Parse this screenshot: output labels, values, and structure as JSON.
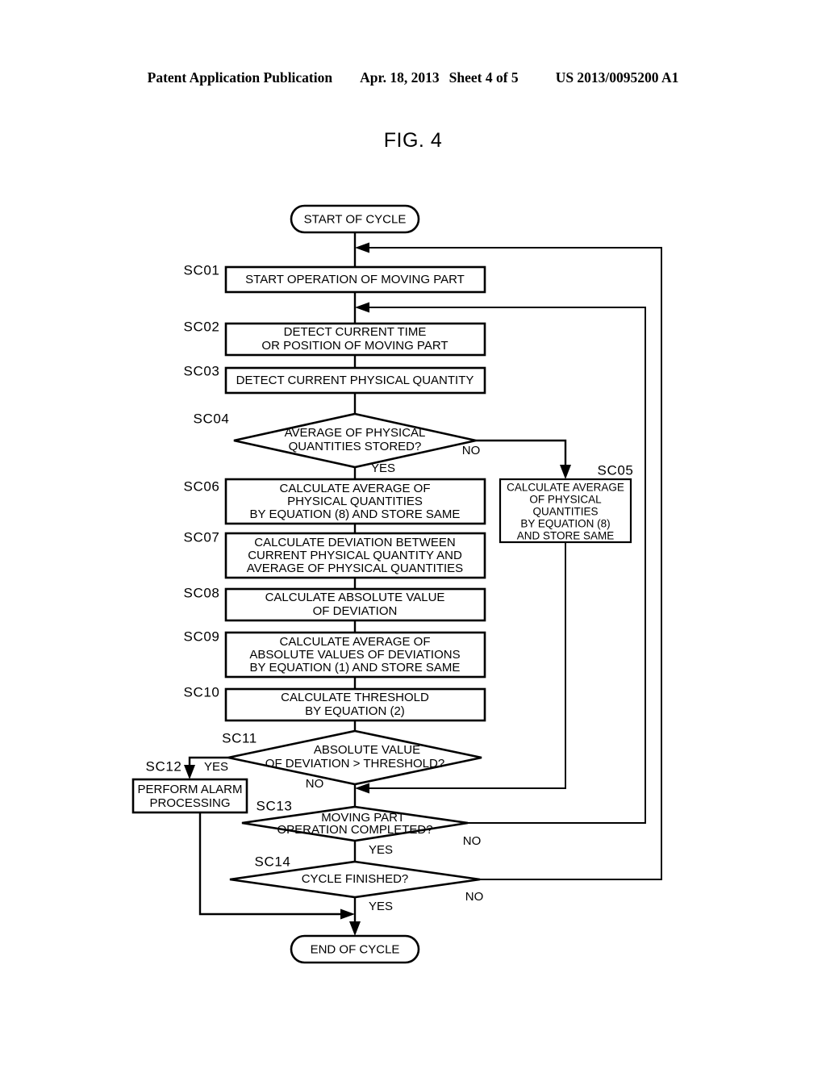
{
  "header": {
    "publication": "Patent Application Publication",
    "date": "Apr. 18, 2013",
    "sheet": "Sheet 4 of 5",
    "number": "US 2013/0095200 A1"
  },
  "figure": {
    "label": "FIG. 4"
  },
  "chart_data": {
    "type": "diagram",
    "title": "FIG. 4",
    "diagram_kind": "flowchart",
    "nodes": [
      {
        "id": "start",
        "step": "",
        "shape": "terminator",
        "text": "START OF CYCLE"
      },
      {
        "id": "sc01",
        "step": "SC01",
        "shape": "process",
        "text": "START OPERATION OF MOVING PART"
      },
      {
        "id": "sc02",
        "step": "SC02",
        "shape": "process",
        "text": "DETECT CURRENT TIME\nOR POSITION OF MOVING PART"
      },
      {
        "id": "sc03",
        "step": "SC03",
        "shape": "process",
        "text": "DETECT CURRENT PHYSICAL QUANTITY"
      },
      {
        "id": "sc04",
        "step": "SC04",
        "shape": "decision",
        "text": "AVERAGE OF PHYSICAL\nQUANTITIES STORED?"
      },
      {
        "id": "sc05",
        "step": "SC05",
        "shape": "process",
        "text": "CALCULATE AVERAGE\nOF PHYSICAL\nQUANTITIES\nBY EQUATION (8)\nAND STORE SAME"
      },
      {
        "id": "sc06",
        "step": "SC06",
        "shape": "process",
        "text": "CALCULATE AVERAGE OF\nPHYSICAL QUANTITIES\nBY EQUATION (8) AND STORE SAME"
      },
      {
        "id": "sc07",
        "step": "SC07",
        "shape": "process",
        "text": "CALCULATE DEVIATION BETWEEN\nCURRENT PHYSICAL QUANTITY AND\nAVERAGE OF PHYSICAL QUANTITIES"
      },
      {
        "id": "sc08",
        "step": "SC08",
        "shape": "process",
        "text": "CALCULATE ABSOLUTE VALUE\nOF DEVIATION"
      },
      {
        "id": "sc09",
        "step": "SC09",
        "shape": "process",
        "text": "CALCULATE AVERAGE OF\nABSOLUTE VALUES OF DEVIATIONS\nBY EQUATION (1) AND STORE SAME"
      },
      {
        "id": "sc10",
        "step": "SC10",
        "shape": "process",
        "text": "CALCULATE THRESHOLD\nBY EQUATION (2)"
      },
      {
        "id": "sc11",
        "step": "SC11",
        "shape": "decision",
        "text": "ABSOLUTE VALUE\nOF DEVIATION > THRESHOLD?"
      },
      {
        "id": "sc12",
        "step": "SC12",
        "shape": "process",
        "text": "PERFORM ALARM\nPROCESSING"
      },
      {
        "id": "sc13",
        "step": "SC13",
        "shape": "decision",
        "text": "MOVING PART\nOPERATION COMPLETED?"
      },
      {
        "id": "sc14",
        "step": "SC14",
        "shape": "decision",
        "text": "CYCLE FINISHED?"
      },
      {
        "id": "end",
        "step": "",
        "shape": "terminator",
        "text": "END OF CYCLE"
      }
    ],
    "edges": [
      {
        "from": "start",
        "to": "sc01",
        "label": ""
      },
      {
        "from": "sc01",
        "to": "sc02",
        "label": ""
      },
      {
        "from": "sc02",
        "to": "sc03",
        "label": ""
      },
      {
        "from": "sc03",
        "to": "sc04",
        "label": ""
      },
      {
        "from": "sc04",
        "to": "sc06",
        "label": "YES"
      },
      {
        "from": "sc04",
        "to": "sc05",
        "label": "NO"
      },
      {
        "from": "sc06",
        "to": "sc07",
        "label": ""
      },
      {
        "from": "sc07",
        "to": "sc08",
        "label": ""
      },
      {
        "from": "sc08",
        "to": "sc09",
        "label": ""
      },
      {
        "from": "sc09",
        "to": "sc10",
        "label": ""
      },
      {
        "from": "sc10",
        "to": "sc11",
        "label": ""
      },
      {
        "from": "sc11",
        "to": "sc12",
        "label": "YES"
      },
      {
        "from": "sc11",
        "to": "sc13",
        "label": "NO"
      },
      {
        "from": "sc05",
        "to": "sc13",
        "label": ""
      },
      {
        "from": "sc13",
        "to": "sc14",
        "label": "YES"
      },
      {
        "from": "sc13",
        "to": "sc02",
        "label": "NO"
      },
      {
        "from": "sc14",
        "to": "end",
        "label": "YES"
      },
      {
        "from": "sc14",
        "to": "sc01",
        "label": "NO"
      },
      {
        "from": "sc12",
        "to": "end",
        "label": ""
      }
    ],
    "branch_labels": {
      "sc04_yes": "YES",
      "sc04_no": "NO",
      "sc11_yes": "YES",
      "sc11_no": "NO",
      "sc13_yes": "YES",
      "sc13_no": "NO",
      "sc14_yes": "YES",
      "sc14_no": "NO"
    },
    "step_labels": [
      "SC01",
      "SC02",
      "SC03",
      "SC04",
      "SC05",
      "SC06",
      "SC07",
      "SC08",
      "SC09",
      "SC10",
      "SC11",
      "SC12",
      "SC13",
      "SC14"
    ],
    "colors": {
      "stroke": "#000000",
      "fill": "#ffffff",
      "background": "#ffffff"
    }
  }
}
